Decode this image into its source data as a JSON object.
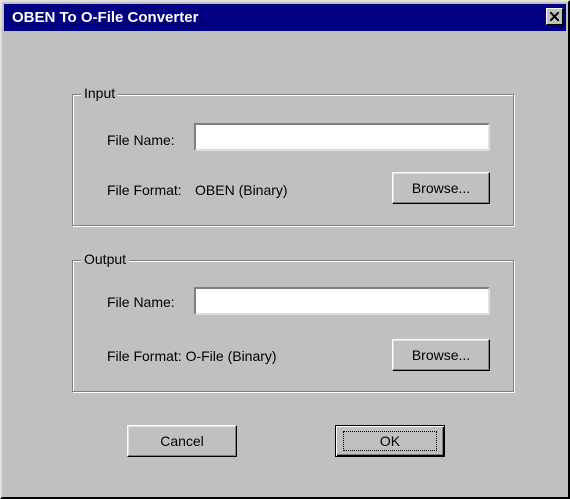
{
  "window": {
    "title": "OBEN To O-File Converter"
  },
  "input_group": {
    "legend": "Input",
    "file_name_label": "File Name:",
    "file_name_value": "",
    "file_format_label": "File Format:",
    "file_format_value": "OBEN (Binary)",
    "browse_label": "Browse..."
  },
  "output_group": {
    "legend": "Output",
    "file_name_label": "File Name:",
    "file_name_value": "",
    "file_format_text": "File Format: O-File (Binary)",
    "browse_label": "Browse..."
  },
  "buttons": {
    "cancel_label": "Cancel",
    "ok_label": "OK"
  },
  "colors": {
    "titlebar": "#000080",
    "dialog_face": "#c0c0c0",
    "title_text": "#ffffff"
  }
}
